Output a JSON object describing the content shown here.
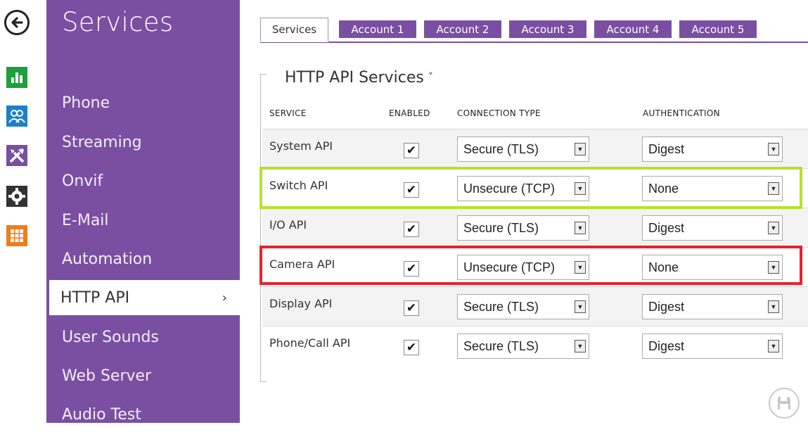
{
  "menu": {
    "title": "Services",
    "items": [
      {
        "label": "Phone"
      },
      {
        "label": "Streaming"
      },
      {
        "label": "Onvif"
      },
      {
        "label": "E-Mail"
      },
      {
        "label": "Automation"
      },
      {
        "label": "HTTP API",
        "active": true,
        "chevron": "›"
      },
      {
        "label": "User Sounds"
      },
      {
        "label": "Web Server"
      },
      {
        "label": "Audio Test"
      }
    ]
  },
  "rail": {
    "icons": [
      "back-arrow-icon",
      "bar-chart-icon",
      "users-icon",
      "tools-icon",
      "gear-icon",
      "grid-icon"
    ],
    "colors": {
      "green": "#1e9e3c",
      "blue": "#1d7fc9",
      "purple": "#7a4fa2",
      "dark": "#333333",
      "orange": "#f07d1c"
    }
  },
  "tabs": [
    "Services",
    "Account 1",
    "Account 2",
    "Account 3",
    "Account 4",
    "Account 5"
  ],
  "section": {
    "title": "HTTP API Services",
    "caret": "˅",
    "columns": {
      "service": "SERVICE",
      "enabled": "ENABLED",
      "connection": "CONNECTION TYPE",
      "authentication": "AUTHENTICATION"
    },
    "rows": [
      {
        "name": "System API",
        "enabled": true,
        "check": "✔",
        "connection": "Secure (TLS)",
        "auth": "Digest"
      },
      {
        "name": "Switch API",
        "enabled": true,
        "check": "✔",
        "connection": "Unsecure (TCP)",
        "auth": "None"
      },
      {
        "name": "I/O API",
        "enabled": true,
        "check": "✔",
        "connection": "Secure (TLS)",
        "auth": "Digest"
      },
      {
        "name": "Camera API",
        "enabled": true,
        "check": "✔",
        "connection": "Unsecure (TCP)",
        "auth": "None"
      },
      {
        "name": "Display API",
        "enabled": true,
        "check": "✔",
        "connection": "Secure (TLS)",
        "auth": "Digest"
      },
      {
        "name": "Phone/Call API",
        "enabled": true,
        "check": "✔",
        "connection": "Secure (TLS)",
        "auth": "Digest"
      }
    ]
  },
  "highlights": {
    "switch_row": "#b5e12f",
    "camera_row": "#e8232b"
  },
  "accent": "#7a4fa2"
}
